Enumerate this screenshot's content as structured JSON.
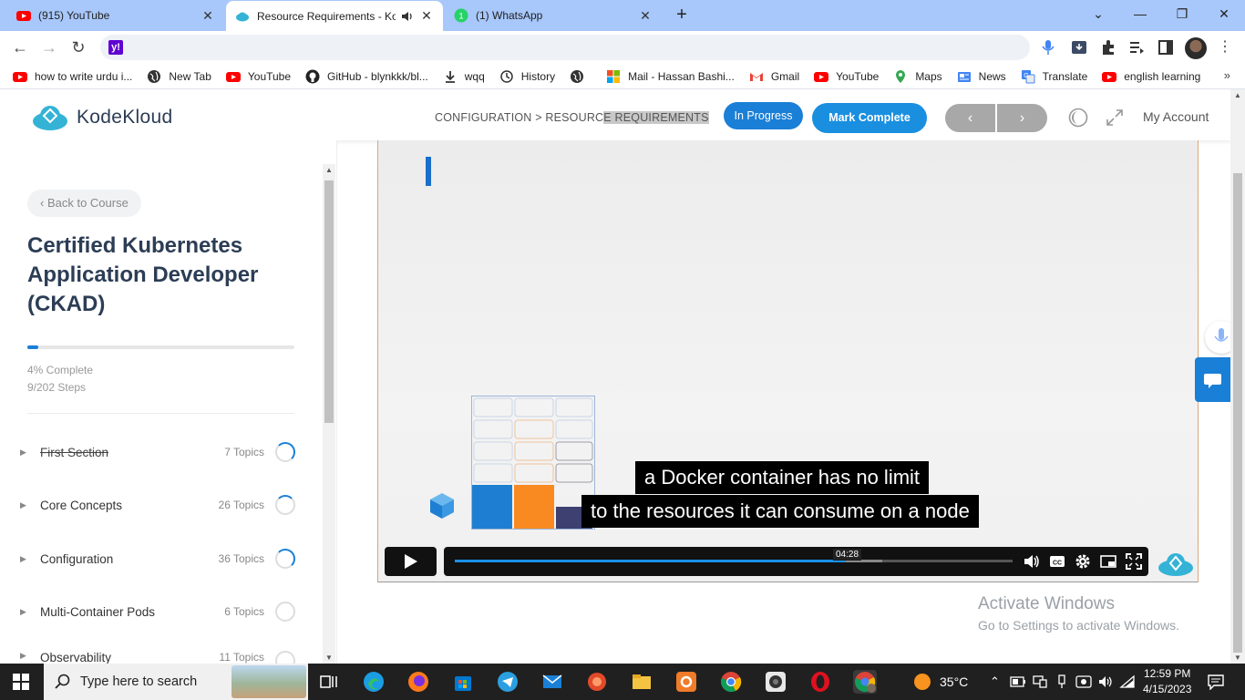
{
  "browser": {
    "tabs": [
      {
        "title": "(915) YouTube",
        "icon": "youtube-icon"
      },
      {
        "title": "Resource Requirements - Ko",
        "icon": "kodekloud-icon",
        "active": true
      },
      {
        "title": "(1) WhatsApp",
        "icon": "whatsapp-icon"
      }
    ],
    "url": "",
    "bookmarks": [
      {
        "label": "how to write urdu i...",
        "icon": "youtube-icon"
      },
      {
        "label": "New Tab",
        "icon": "globe-icon"
      },
      {
        "label": "YouTube",
        "icon": "youtube-icon"
      },
      {
        "label": "GitHub - blynkkk/bl...",
        "icon": "github-icon"
      },
      {
        "label": "wqq",
        "icon": "download-icon"
      },
      {
        "label": "History",
        "icon": "history-icon"
      },
      {
        "label": "",
        "icon": "globe-icon"
      },
      {
        "label": "Mail - Hassan Bashi...",
        "icon": "microsoft-icon"
      },
      {
        "label": "Gmail",
        "icon": "gmail-icon"
      },
      {
        "label": "YouTube",
        "icon": "youtube-icon"
      },
      {
        "label": "Maps",
        "icon": "maps-icon"
      },
      {
        "label": "News",
        "icon": "news-icon"
      },
      {
        "label": "Translate",
        "icon": "translate-icon"
      },
      {
        "label": "english learning",
        "icon": "youtube-icon"
      }
    ],
    "bookmarks_more": "»"
  },
  "header": {
    "logo_text": "KodeKloud",
    "breadcrumb_a": "CONFIGURATION > RESOURC",
    "breadcrumb_b": "E REQUIREMENTS",
    "in_progress": "In Progress",
    "mark_complete": "Mark Complete",
    "prev": "‹",
    "next": "›",
    "my_account": "My Account"
  },
  "sidebar": {
    "back": "‹  Back to Course",
    "course_title": "Certified Kubernetes Application Developer (CKAD)",
    "progress_percent": 4,
    "progress_label": "4% Complete",
    "steps_label": "9/202 Steps",
    "sections": [
      {
        "name": "First Section",
        "count": "7 Topics",
        "completed": true
      },
      {
        "name": "Core Concepts",
        "count": "26 Topics"
      },
      {
        "name": "Configuration",
        "count": "36 Topics"
      },
      {
        "name": "Multi-Container Pods",
        "count": "6 Topics"
      },
      {
        "name": "Observability",
        "count": "11 Topics"
      }
    ]
  },
  "video": {
    "caption_line1": "a Docker container has no limit",
    "caption_line2": "to the resources it can consume on a node",
    "current_time": "04:28",
    "played_fraction": 0.701,
    "buffered_fraction": 0.766
  },
  "watermark": {
    "line1": "Activate Windows",
    "line2": "Go to Settings to activate Windows."
  },
  "taskbar": {
    "search_placeholder": "Type here to search",
    "temperature": "35°C",
    "time": "12:59 PM",
    "date": "4/15/2023"
  }
}
